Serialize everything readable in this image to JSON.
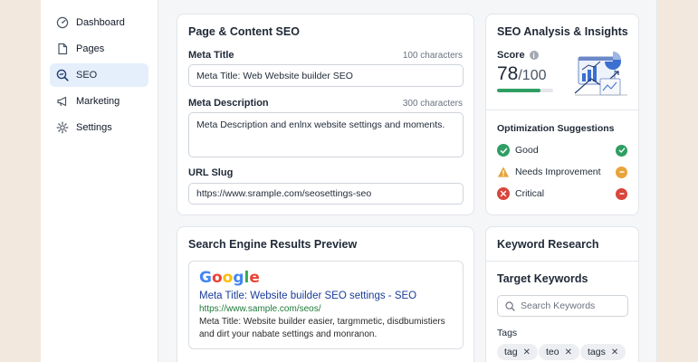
{
  "sidebar": {
    "items": [
      {
        "label": "Dashboard",
        "icon": "dashboard-icon"
      },
      {
        "label": "Pages",
        "icon": "page-icon"
      },
      {
        "label": "SEO",
        "icon": "seo-search-icon",
        "active": true
      },
      {
        "label": "Marketing",
        "icon": "megaphone-icon"
      },
      {
        "label": "Settings",
        "icon": "gear-icon"
      }
    ]
  },
  "content_seo": {
    "title": "Page & Content SEO",
    "meta_title": {
      "label": "Meta Title",
      "hint": "100 characters",
      "value": "Meta Title: Web Website builder SEO"
    },
    "meta_description": {
      "label": "Meta Description",
      "hint": "300 characters",
      "value": "Meta Description and enlnx website settings and moments."
    },
    "url_slug": {
      "label": "URL Slug",
      "value": "https://www.srample.com/seosettings-seo"
    }
  },
  "analysis": {
    "title": "SEO Analysis & Insights",
    "score_label": "Score",
    "score_value": "78",
    "score_max": "/100",
    "score_progress": 0.78,
    "suggestions_title": "Optimization Suggestions",
    "suggestions": [
      {
        "label": "Good",
        "status": "good"
      },
      {
        "label": "Needs Improvement",
        "status": "warning"
      },
      {
        "label": "Critical",
        "status": "critical"
      }
    ]
  },
  "serp": {
    "title": "Search Engine Results Preview",
    "brand": "Google",
    "result_title": "Meta Title: Website builder SEO settings - SEO",
    "result_url": "https://www.sample.com/seos/",
    "result_desc_1": "Meta Title: Website builder easier, targmmetic, disdbumistiers",
    "result_desc_2": "and dirt your nabate settings and monranon."
  },
  "keywords": {
    "title": "Keyword Research",
    "target_title": "Target Keywords",
    "search_placeholder": "Search Keywords",
    "tags_label": "Tags",
    "tags": [
      "tag",
      "teo",
      "tags"
    ]
  },
  "colors": {
    "accent": "#2f9e63",
    "active_nav": "#e5eefb",
    "good": "#2f9e63",
    "warning": "#e8a33a",
    "critical": "#d9453b",
    "link": "#1a3c99"
  }
}
